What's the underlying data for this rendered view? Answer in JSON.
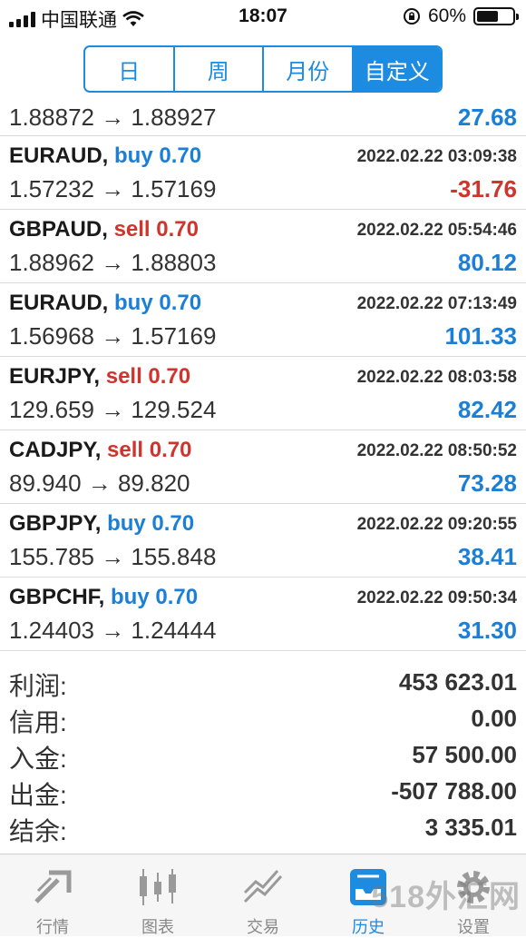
{
  "status_bar": {
    "carrier": "中国联通",
    "time": "18:07",
    "battery": "60%",
    "battery_level": 0.6
  },
  "segments": [
    {
      "label": "日",
      "active": false
    },
    {
      "label": "周",
      "active": false
    },
    {
      "label": "月份",
      "active": false
    },
    {
      "label": "自定义",
      "active": true
    }
  ],
  "partial_row": {
    "prices": "1.88872 → 1.88927",
    "profit": "27.68"
  },
  "trades": [
    {
      "symbol": "EURAUD,",
      "side": "buy 0.70",
      "time": "2022.02.22 03:09:38",
      "prices": "1.57232 → 1.57169",
      "profit": "-31.76",
      "negative": true
    },
    {
      "symbol": "GBPAUD,",
      "side": "sell 0.70",
      "time": "2022.02.22 05:54:46",
      "prices": "1.88962 → 1.88803",
      "profit": "80.12",
      "negative": false
    },
    {
      "symbol": "EURAUD,",
      "side": "buy 0.70",
      "time": "2022.02.22 07:13:49",
      "prices": "1.56968 → 1.57169",
      "profit": "101.33",
      "negative": false
    },
    {
      "symbol": "EURJPY,",
      "side": "sell 0.70",
      "time": "2022.02.22 08:03:58",
      "prices": "129.659 → 129.524",
      "profit": "82.42",
      "negative": false
    },
    {
      "symbol": "CADJPY,",
      "side": "sell 0.70",
      "time": "2022.02.22 08:50:52",
      "prices": "89.940 → 89.820",
      "profit": "73.28",
      "negative": false
    },
    {
      "symbol": "GBPJPY,",
      "side": "buy 0.70",
      "time": "2022.02.22 09:20:55",
      "prices": "155.785 → 155.848",
      "profit": "38.41",
      "negative": false
    },
    {
      "symbol": "GBPCHF,",
      "side": "buy 0.70",
      "time": "2022.02.22 09:50:34",
      "prices": "1.24403 → 1.24444",
      "profit": "31.30",
      "negative": false
    }
  ],
  "summary": [
    {
      "label": "利润:",
      "value": "453 623.01"
    },
    {
      "label": "信用:",
      "value": "0.00"
    },
    {
      "label": "入金:",
      "value": "57 500.00"
    },
    {
      "label": "出金:",
      "value": "-507 788.00"
    },
    {
      "label": "结余:",
      "value": "3 335.01"
    }
  ],
  "tabs": [
    {
      "label": "行情",
      "icon": "quotes-icon",
      "active": false
    },
    {
      "label": "图表",
      "icon": "chart-icon",
      "active": false
    },
    {
      "label": "交易",
      "icon": "trade-icon",
      "active": false
    },
    {
      "label": "历史",
      "icon": "history-icon",
      "active": true
    },
    {
      "label": "设置",
      "icon": "gear-icon",
      "active": false
    }
  ],
  "watermark": "518外汇网",
  "colors": {
    "accent": "#1c8be0",
    "buy": "#1c7fd6",
    "sell": "#d0342c",
    "profit_pos": "#1c7fd6",
    "profit_neg": "#d0342c"
  }
}
